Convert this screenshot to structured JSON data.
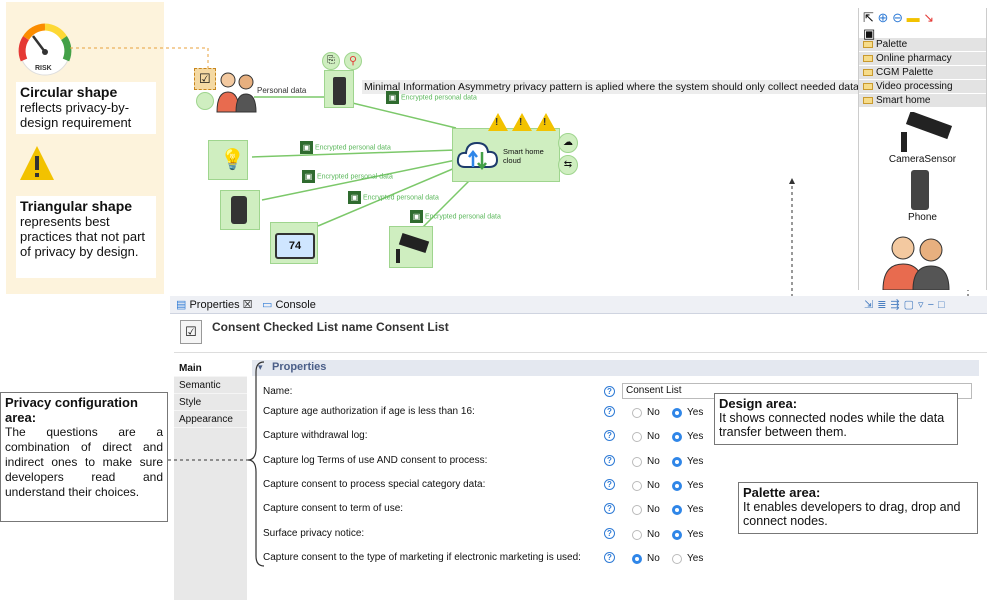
{
  "legend": {
    "circular_title": "Circular shape",
    "circular_desc": "reflects privacy-by-design requirement",
    "triangle_title": "Triangular shape",
    "triangle_desc": "represents best practices that not part of privacy by design.",
    "gauge_text": "RISK"
  },
  "canvas": {
    "edge_personal_data": "Personal data",
    "edge_encrypted": "Encrypted personal data",
    "cloud_label": "Smart home cloud",
    "tooltip": "Minimal Information Asymmetry privacy pattern is aplied where the system should only collect needed data.",
    "thermostat_value": "74"
  },
  "palette": {
    "toolbar": [
      "select-icon",
      "zoom-in-icon",
      "zoom-out-icon",
      "note-icon",
      "connector-icon"
    ],
    "folders": [
      "Palette",
      "Online pharmacy",
      "CGM Palette",
      "Video processing",
      "Smart home"
    ],
    "items": [
      "CameraSensor",
      "Phone"
    ]
  },
  "properties_view": {
    "tab_properties": "Properties",
    "tab_properties_close": "☒",
    "tab_console": "Console",
    "header_title": "Consent Checked List name Consent List",
    "side_tabs": [
      "Main",
      "Semantic",
      "Style",
      "Appearance"
    ],
    "section_title": "Properties",
    "name_label": "Name:",
    "name_value": "Consent List",
    "yes_label": "Yes",
    "no_label": "No",
    "rows": [
      {
        "label": "Capture age authorization if age is less than 16:",
        "value": "Yes"
      },
      {
        "label": "Capture withdrawal log:",
        "value": "Yes"
      },
      {
        "label": "Capture log Terms of use AND consent to process:",
        "value": "Yes"
      },
      {
        "label": "Capture consent to process special category data:",
        "value": "Yes"
      },
      {
        "label": "Capture consent to term of use:",
        "value": "Yes"
      },
      {
        "label": "Surface privacy notice:",
        "value": "Yes"
      },
      {
        "label": "Capture consent to the type of marketing if electronic marketing is used:",
        "value": "No"
      }
    ]
  },
  "annotations": {
    "privacy_title": "Privacy configuration area:",
    "privacy_desc": "The questions are a combination of direct and indirect ones to make sure developers read and understand their choices.",
    "design_title": "Design area:",
    "design_desc": "It shows connected nodes while the data transfer between them.",
    "palette_title": "Palette area:",
    "palette_desc": "It enables developers to drag, drop and connect nodes."
  },
  "colors": {
    "node_fill": "#cfeec0",
    "edge_green": "#7cc86a",
    "radio_selected": "#2f86e8",
    "legend_bg": "#fdf3dc",
    "warning_yellow": "#f2c200"
  }
}
